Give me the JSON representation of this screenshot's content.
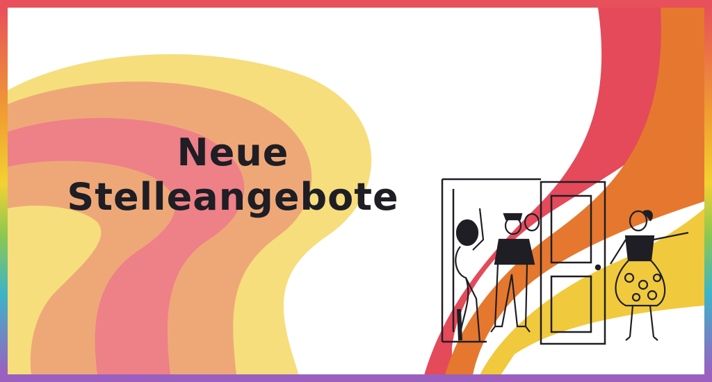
{
  "banner": {
    "title_line1": "Neue",
    "title_line2": "Stelleangebote"
  },
  "colors": {
    "red": "#e44a5a",
    "pink": "#ee8088",
    "salmon": "#eea878",
    "orange": "#e5782e",
    "yellow": "#f5dc78",
    "ink": "#1e1e24"
  },
  "illustration": {
    "icons": [
      "door-icon",
      "waving-woman-icon",
      "man-in-cap-icon",
      "woman-in-skirt-icon"
    ]
  }
}
